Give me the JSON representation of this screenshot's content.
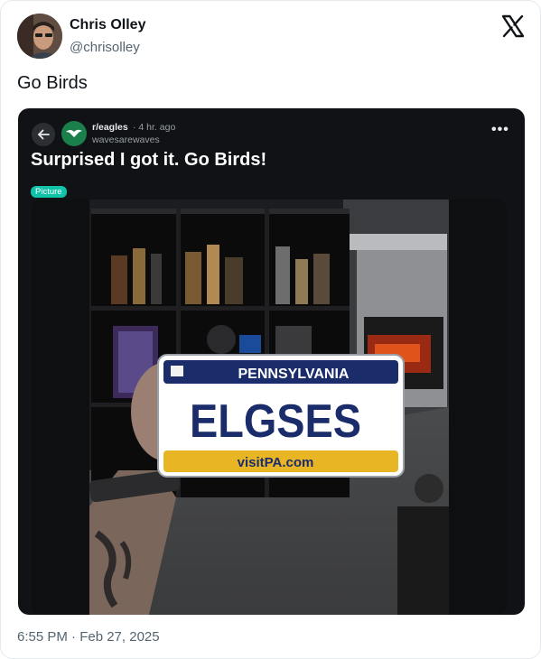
{
  "author": {
    "name": "Chris Olley",
    "handle": "@chrisolley"
  },
  "tweet": {
    "text": "Go Birds",
    "timestamp": "6:55 PM · Feb 27, 2025"
  },
  "embed": {
    "subreddit": "r/eagles",
    "time": "· 4 hr. ago",
    "username": "wavesarewaves",
    "title": "Surprised I got it. Go Birds!",
    "flair": "Picture",
    "more_label": "•••",
    "photo": {
      "plate_state": "PENNSYLVANIA",
      "plate_text": "ELGSES",
      "plate_footer": "visitPA.com"
    }
  },
  "icons": {
    "brand": "x-logo-icon",
    "back": "arrow-left-icon",
    "subreddit": "eagle-icon",
    "menu": "more-horizontal-icon"
  },
  "colors": {
    "flair": "#0fc3a8",
    "subreddit_icon": "#1a7f4a",
    "plate_navy": "#1b2c6b",
    "plate_gold": "#e8b624"
  }
}
